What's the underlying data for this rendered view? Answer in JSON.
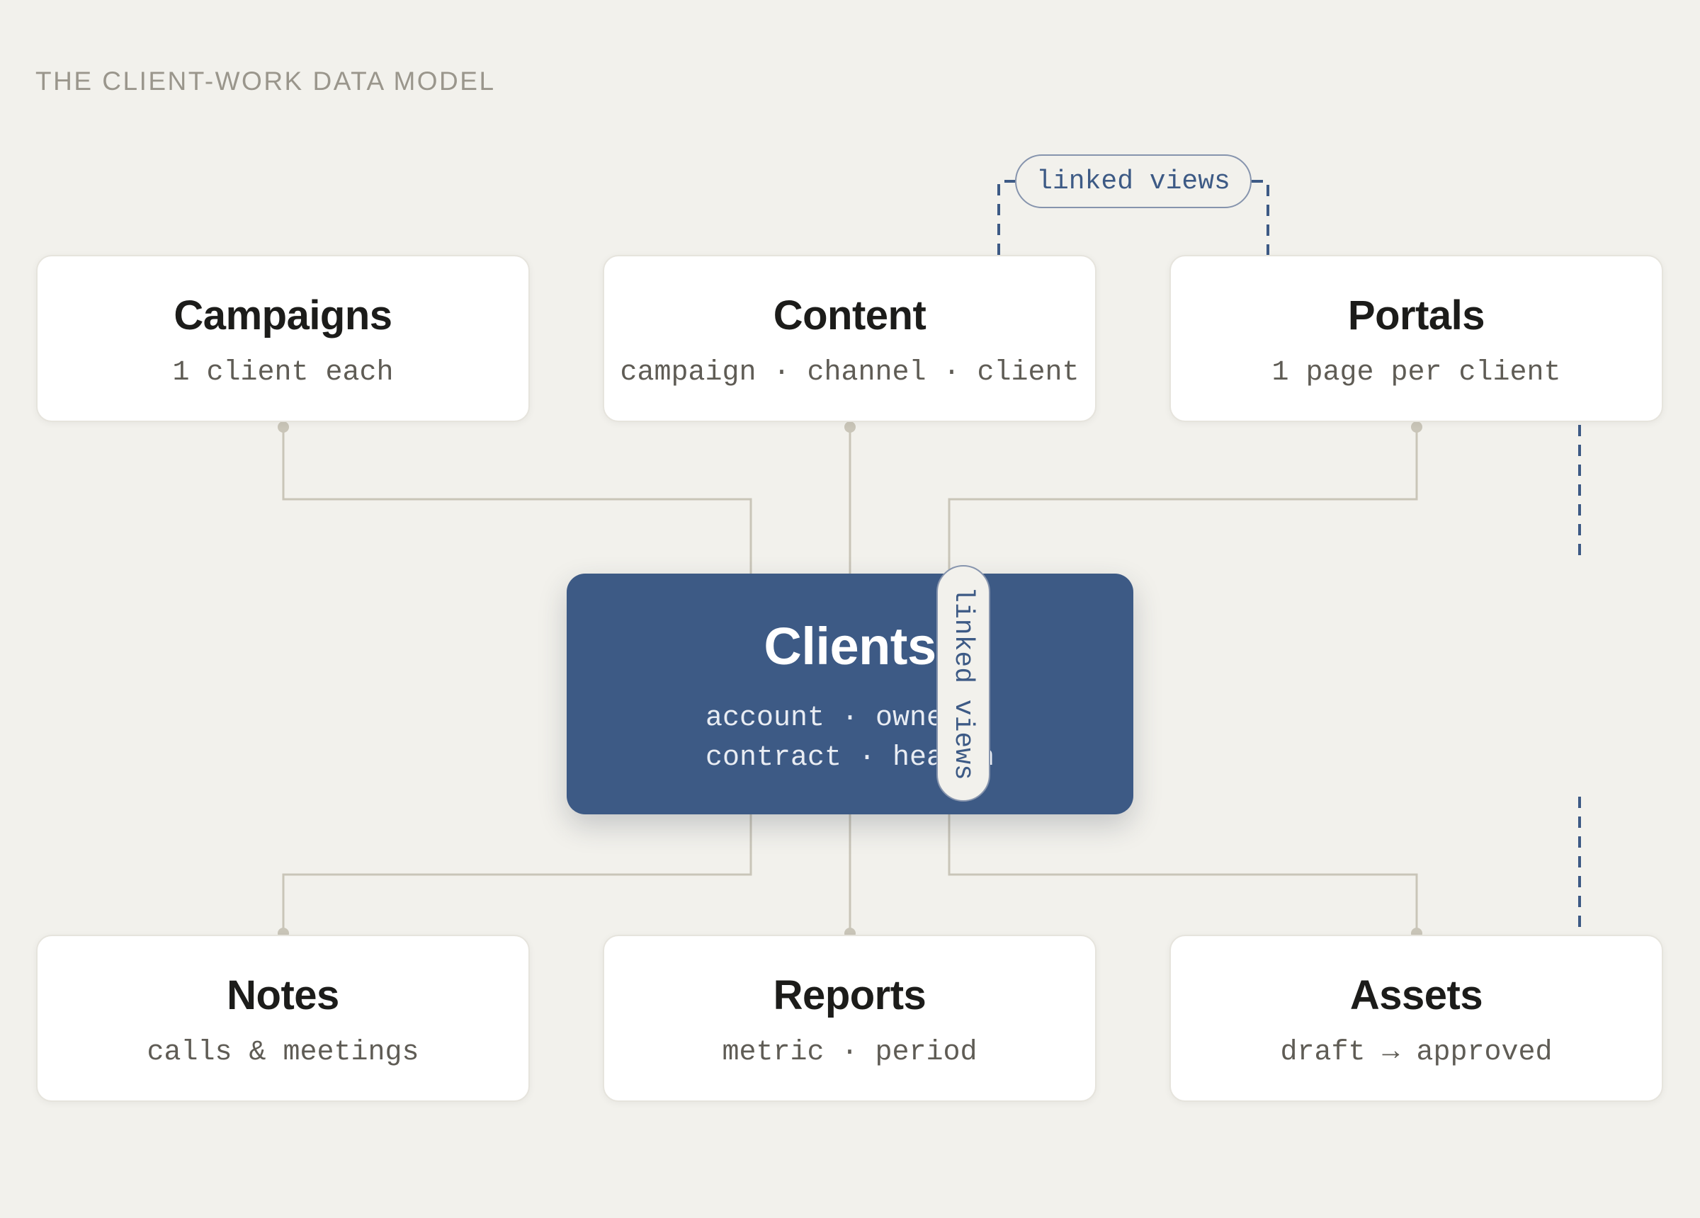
{
  "title": "THE CLIENT-WORK DATA MODEL",
  "hub": {
    "name": "Clients",
    "fields_line1": "account · owner ·",
    "fields_line2": "contract · health"
  },
  "entities": {
    "campaigns": {
      "name": "Campaigns",
      "sub": "1 client each"
    },
    "content": {
      "name": "Content",
      "sub": "campaign · channel · client"
    },
    "portals": {
      "name": "Portals",
      "sub": "1 page per client"
    },
    "notes": {
      "name": "Notes",
      "sub": "calls & meetings"
    },
    "reports": {
      "name": "Reports",
      "sub": "metric · period"
    },
    "assets": {
      "name": "Assets",
      "sub": "draft → approved"
    }
  },
  "links": {
    "content_portals": "linked views",
    "portals_assets": "linked views"
  },
  "colors": {
    "background": "#f2f1ec",
    "hub": "#3d5a85",
    "connector": "#c9c5b8",
    "linked_view": "#3d5a85"
  }
}
